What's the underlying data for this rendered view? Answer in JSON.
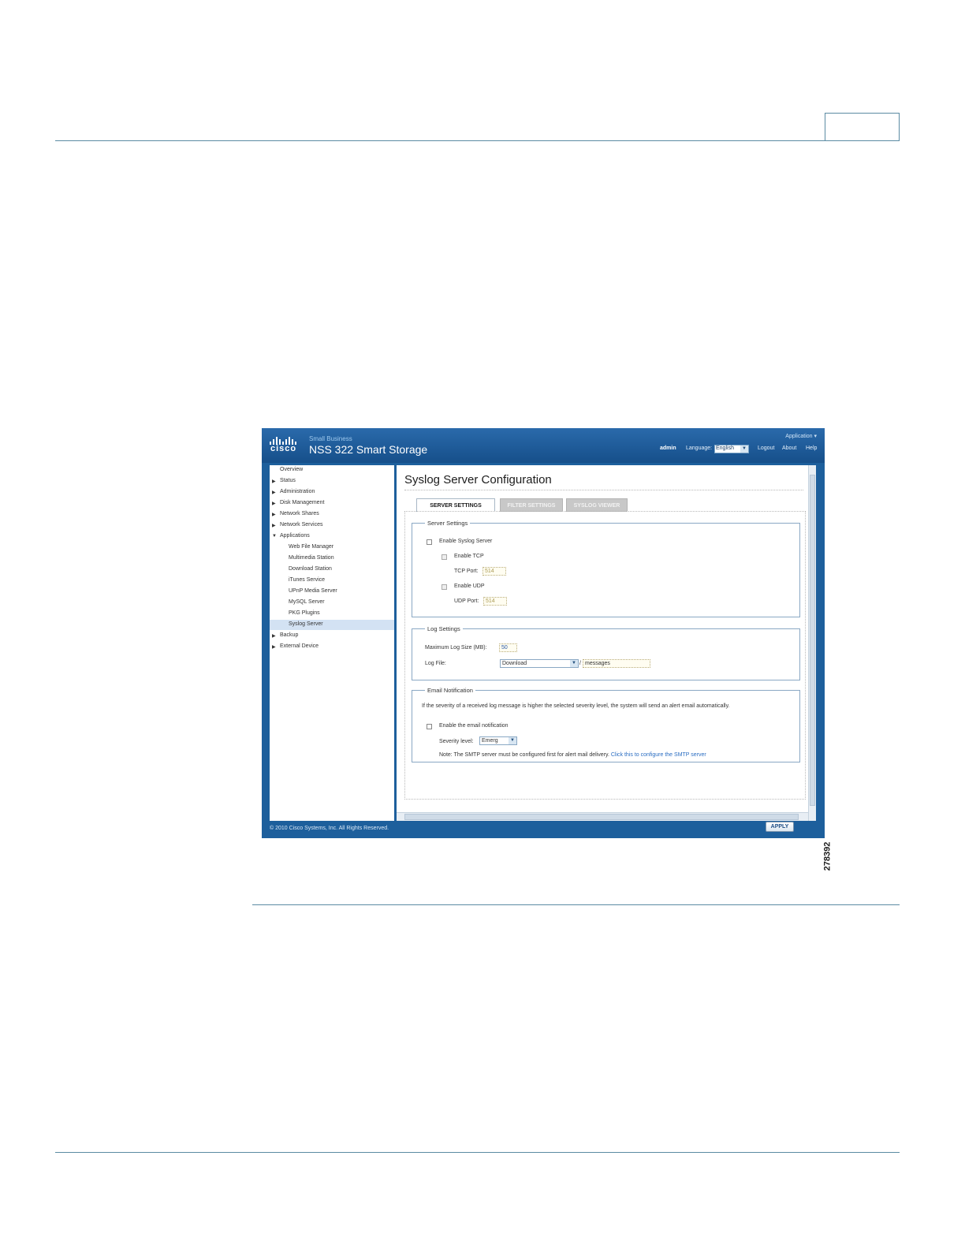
{
  "screenshot": {
    "brand": {
      "logo_text": "cisco",
      "small_business": "Small Business",
      "product": "NSS 322 Smart Storage"
    },
    "header": {
      "application_menu": "Application ▾",
      "user": "admin",
      "language_label": "Language:",
      "language_value": "English",
      "logout": "Logout",
      "about": "About",
      "help": "Help"
    },
    "sidebar": {
      "items": [
        {
          "label": "Overview"
        },
        {
          "label": "Status"
        },
        {
          "label": "Administration"
        },
        {
          "label": "Disk Management"
        },
        {
          "label": "Network Shares"
        },
        {
          "label": "Network Services"
        },
        {
          "label": "Applications"
        },
        {
          "label": "Web File Manager"
        },
        {
          "label": "Multimedia Station"
        },
        {
          "label": "Download Station"
        },
        {
          "label": "iTunes Service"
        },
        {
          "label": "UPnP Media Server"
        },
        {
          "label": "MySQL Server"
        },
        {
          "label": "PKG Plugins"
        },
        {
          "label": "Syslog Server"
        },
        {
          "label": "Backup"
        },
        {
          "label": "External Device"
        }
      ]
    },
    "main": {
      "title": "Syslog Server Configuration",
      "tabs": [
        {
          "label": "SERVER SETTINGS"
        },
        {
          "label": "FILTER SETTINGS"
        },
        {
          "label": "SYSLOG VIEWER"
        }
      ],
      "server_settings": {
        "legend": "Server Settings",
        "enable_syslog": "Enable Syslog Server",
        "enable_tcp": "Enable TCP",
        "tcp_port_label": "TCP Port:",
        "tcp_port_value": "514",
        "enable_udp": "Enable UDP",
        "udp_port_label": "UDP Port:",
        "udp_port_value": "514"
      },
      "log_settings": {
        "legend": "Log Settings",
        "max_size_label": "Maximum Log Size (MB):",
        "max_size_value": "50",
        "log_file_label": "Log File:",
        "log_file_value": "Download",
        "separator": "/",
        "messages_value": "messages"
      },
      "email_notification": {
        "legend": "Email Notification",
        "description": "If the severity of a received log message is higher the selected severity level, the system will send an alert email automatically.",
        "enable_label": "Enable the email notification",
        "severity_label": "Severity level:",
        "severity_value": "Emerg",
        "note": "Note: The SMTP server must be configured first for alert mail delivery.",
        "note_link": "Click this to configure the SMTP server"
      },
      "apply_label": "APPLY"
    },
    "footer": "© 2010 Cisco Systems, Inc. All Rights Reserved."
  },
  "figure_number": "278392",
  "colors": {
    "accent_blue": "#1d5f9c",
    "rule": "#5b8ba3",
    "link": "#2a6dc2"
  }
}
